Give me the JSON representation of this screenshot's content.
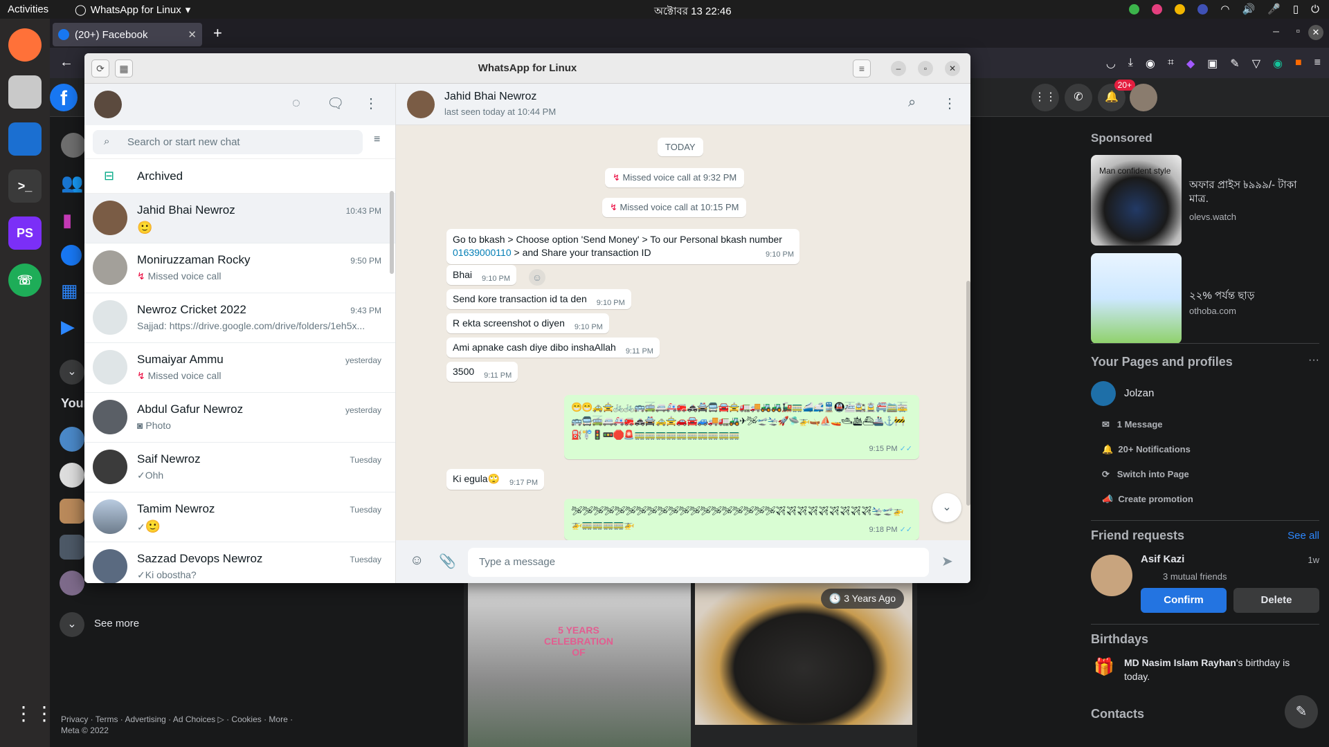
{
  "topbar": {
    "activities": "Activities",
    "app_name": "WhatsApp for Linux",
    "clock": "অক্টোবর 13  22:46"
  },
  "browser": {
    "tab_title": "(20+) Facebook",
    "new_tab": "+",
    "notif_badge": "20+"
  },
  "fb": {
    "left_section": "Your",
    "see_more": "See more",
    "footer": "Privacy · Terms · Advertising · Ad Choices ▷ · Cookies · More · Meta © 2022",
    "sponsored": "Sponsored",
    "ads": [
      {
        "headline": "অফার প্রাইস ৳৯৯৯/- টাকা মাত্র.",
        "domain": "olevs.watch",
        "img_caption": "Man confident style"
      },
      {
        "headline": "২২% পর্যন্ত ছাড়",
        "domain": "othoba.com"
      }
    ],
    "pages_title": "Your Pages and profiles",
    "page_name": "Jolzan",
    "page_items": [
      "1 Message",
      "20+ Notifications",
      "Switch into Page",
      "Create promotion"
    ],
    "friend_requests": "Friend requests",
    "see_all": "See all",
    "requester": "Asif Kazi",
    "req_time": "1w",
    "mutual": "3 mutual friends",
    "confirm": "Confirm",
    "delete": "Delete",
    "birthdays": "Birthdays",
    "birthday_name": "MD Nasim Islam Rayhan",
    "birthday_text": "'s birthday is today.",
    "contacts": "Contacts",
    "photo_badge": "3 Years Ago",
    "photo_text": "5 YEARS CELEBRATION OF"
  },
  "wa": {
    "title": "WhatsApp for Linux",
    "search_placeholder": "Search or start new chat",
    "archived": "Archived",
    "chats": [
      {
        "name": "Jahid Bhai Newroz",
        "time": "10:43 PM",
        "last": "🙂"
      },
      {
        "name": "Moniruzzaman Rocky",
        "time": "9:50 PM",
        "last": "Missed voice call"
      },
      {
        "name": "Newroz Cricket 2022",
        "time": "9:43 PM",
        "last": "Sajjad: https://drive.google.com/drive/folders/1eh5x..."
      },
      {
        "name": "Sumaiyar Ammu",
        "time": "yesterday",
        "last": "Missed voice call"
      },
      {
        "name": "Abdul Gafur Newroz",
        "time": "yesterday",
        "last": "Photo"
      },
      {
        "name": "Saif Newroz",
        "time": "Tuesday",
        "last": "Ohh"
      },
      {
        "name": "Tamim Newroz",
        "time": "Tuesday",
        "last": "🙂"
      },
      {
        "name": "Sazzad Devops Newroz",
        "time": "Tuesday",
        "last": "Ki obostha?"
      }
    ],
    "contact_name": "Jahid Bhai Newroz",
    "contact_status": "last seen today at 10:44 PM",
    "today": "TODAY",
    "missed1": "Missed voice call at 9:32 PM",
    "missed2": "Missed voice call at 10:15 PM",
    "messages": [
      {
        "text": "Go to bkash > Choose option 'Send Money' > To our Personal bkash number",
        "link": "01639000110",
        "after": " > and Share your transaction ID",
        "time": "9:10 PM"
      },
      {
        "text": "Bhai",
        "time": "9:10 PM"
      },
      {
        "text": "Send kore transaction id ta den",
        "time": "9:10 PM"
      },
      {
        "text": "R ekta screenshot o diyen",
        "time": "9:10 PM"
      },
      {
        "text": "Ami apnake cash diye dibo inshaAllah",
        "time": "9:11 PM"
      },
      {
        "text": "3500",
        "time": "9:11 PM"
      },
      {
        "text": "Ki egula🙄",
        "time": "9:17 PM"
      }
    ],
    "out1_text": "😁😁🚕🚖🚲🚲🚌🚎🚐🚑🚒🚓🚔🚍🚘🚖🚛🚚🚜🚜🚂🚃🚄🚅🚆🚇🚈🚉🚊🚝🚞🚋🚌🚍🚎🚐🚑🚒🚓🚔🚕🚖🚗🚘🚙🚚🚛🚜✈🛩🛫🛬🚀🛸🚁🛶⛵🚤🛥🛳⛴🚢⚓🚧⛽🚏🚦🚥🛑🚨🚃🚃🚃🚃🚃🚃🚃🚃🚃🚃",
    "out1_time": "9:15 PM",
    "out2_text": "🛩🛩🛩🛩🛩🛩🛩🛩🛩🛩🛩🛩🛩🛩🛩🛩🛩🛩🛩✈✈✈✈✈✈✈✈✈🛬🛫🚁🚁🚃🚃🚃🚃🚁",
    "out2_time": "9:18 PM",
    "composer_placeholder": "Type a message"
  }
}
